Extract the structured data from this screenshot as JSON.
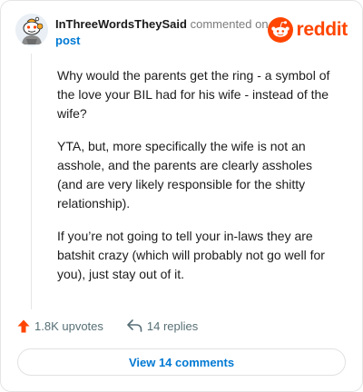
{
  "comment": {
    "author": "InThreeWordsTheySaid",
    "commented_text": "commented on",
    "post_link_text": "post",
    "paragraphs": [
      "Why would the parents get the ring - a symbol of the love your BIL had for his wife - instead of the wife?",
      "YTA, but, more specifically the wife is not an asshole, and the parents are clearly assholes (and are very likely responsible for the shitty relationship).",
      "If you’re not going to tell your in-laws they are batshit crazy (which will probably not go well for you), just stay out of it."
    ]
  },
  "brand": {
    "logo_text": "reddit",
    "color": "#ff4500"
  },
  "actions": {
    "upvotes_label": "1.8K upvotes",
    "replies_label": "14 replies"
  },
  "view_comments_label": "View 14 comments",
  "colors": {
    "accent": "#0079d3",
    "upvote": "#ff4500",
    "muted": "#576f76"
  },
  "icons": {
    "upvote": "upvote-arrow-icon",
    "reply": "reply-arrow-icon",
    "brand": "reddit-snoo-icon",
    "avatar": "snoo-avatar"
  }
}
